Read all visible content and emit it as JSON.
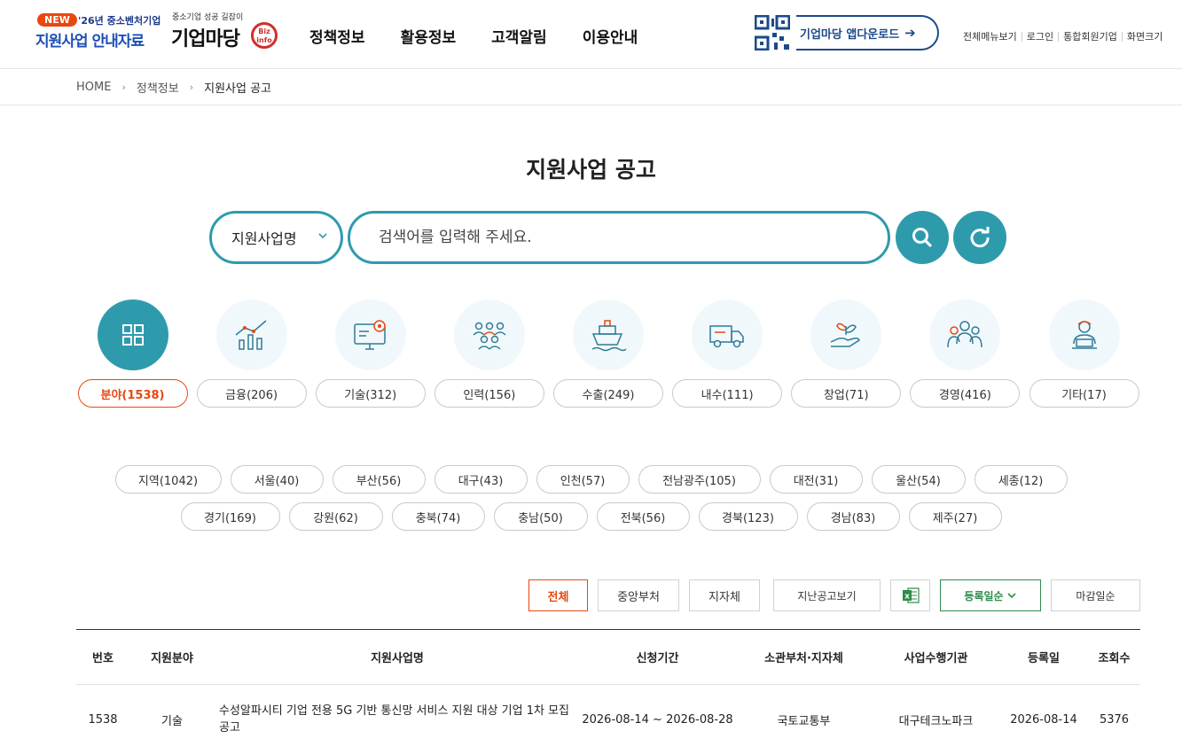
{
  "header": {
    "promo": {
      "badge": "NEW",
      "year": "'26년 중소벤처기업",
      "title": "지원사업 안내자료"
    },
    "logo": {
      "tagline": "중소기업 성공 길잡이",
      "name": "기업마당",
      "badge_line1": "Biz",
      "badge_line2": "info"
    },
    "nav": [
      "정책정보",
      "활용정보",
      "고객알림",
      "이용안내"
    ],
    "app_download": "기업마당 앱다운로드",
    "util": [
      "전체메뉴보기",
      "로그인",
      "통합회원기업",
      "화면크기"
    ]
  },
  "breadcrumb": [
    "HOME",
    "정책정보",
    "지원사업 공고"
  ],
  "page_title": "지원사업 공고",
  "search": {
    "select_value": "지원사업명",
    "placeholder": "검색어를 입력해 주세요."
  },
  "categories": [
    {
      "label": "분야(1538)",
      "icon": "grid-icon",
      "active": true
    },
    {
      "label": "금융(206)",
      "icon": "chart-icon"
    },
    {
      "label": "기술(312)",
      "icon": "monitor-gear-icon"
    },
    {
      "label": "인력(156)",
      "icon": "people-icon"
    },
    {
      "label": "수출(249)",
      "icon": "ship-icon"
    },
    {
      "label": "내수(111)",
      "icon": "truck-icon"
    },
    {
      "label": "창업(71)",
      "icon": "sprout-hand-icon"
    },
    {
      "label": "경영(416)",
      "icon": "business-team-icon"
    },
    {
      "label": "기타(17)",
      "icon": "person-laptop-icon"
    }
  ],
  "regions_row1": [
    "지역(1042)",
    "서울(40)",
    "부산(56)",
    "대구(43)",
    "인천(57)",
    "전남광주(105)",
    "대전(31)",
    "울산(54)",
    "세종(12)"
  ],
  "regions_row2": [
    "경기(169)",
    "강원(62)",
    "충북(74)",
    "충남(50)",
    "전북(56)",
    "경북(123)",
    "경남(83)",
    "제주(27)"
  ],
  "filters": {
    "all": "전체",
    "central": "중앙부처",
    "local": "지자체",
    "past": "지난공고보기",
    "sort_reg": "등록일순",
    "sort_deadline": "마감일순"
  },
  "table": {
    "headers": [
      "번호",
      "지원분야",
      "지원사업명",
      "신청기간",
      "소관부처·지자체",
      "사업수행기관",
      "등록일",
      "조회수"
    ],
    "rows": [
      [
        "1538",
        "기술",
        "수성알파시티 기업 전용 5G 기반 통신망 서비스 지원 대상 기업 1차 모집 공고",
        "2026-08-14 ~ 2026-08-28",
        "국토교통부",
        "대구테크노파크",
        "2026-08-14",
        "5376"
      ]
    ]
  },
  "colors": {
    "accent": "#2e9bad",
    "active": "#e8470f",
    "excel_green": "#2e8b4a",
    "brand_blue": "#1b4a8a"
  }
}
